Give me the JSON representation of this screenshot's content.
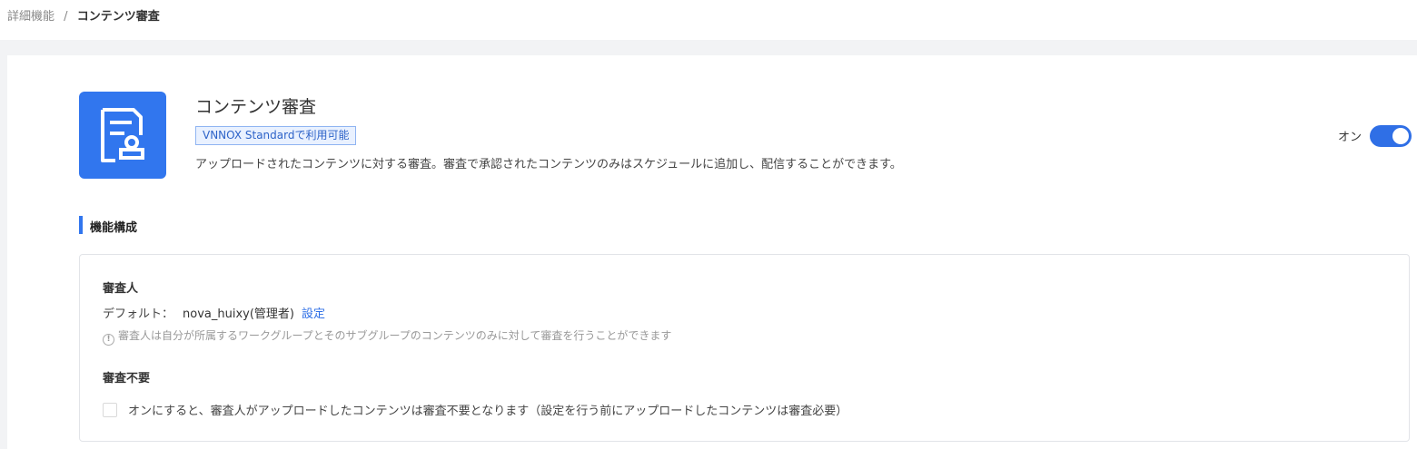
{
  "breadcrumb": {
    "parent": "詳細機能",
    "separator": "/",
    "current": "コンテンツ審査"
  },
  "feature": {
    "icon": "document-stamp-icon",
    "title": "コンテンツ審査",
    "badge": "VNNOX Standardで利用可能",
    "description": "アップロードされたコンテンツに対する審査。審査で承認されたコンテンツのみはスケジュールに追加し、配信することができます。",
    "toggle_label": "オン",
    "enabled": true
  },
  "section": {
    "title": "機能構成"
  },
  "reviewer": {
    "title": "審査人",
    "default_label": "デフォルト：",
    "default_value": "nova_huixy(管理者)",
    "setting_link": "設定",
    "note": "審査人は自分が所属するワークグループとそのサブグループのコンテンツのみに対して審査を行うことができます"
  },
  "exemption": {
    "title": "審査不要",
    "checkbox_label": "オンにすると、審査人がアップロードしたコンテンツは審査不要となります（設定を行う前にアップロードしたコンテンツは審査必要）",
    "checked": false
  },
  "colors": {
    "accent": "#3176ee",
    "link": "#2f6fe6"
  }
}
